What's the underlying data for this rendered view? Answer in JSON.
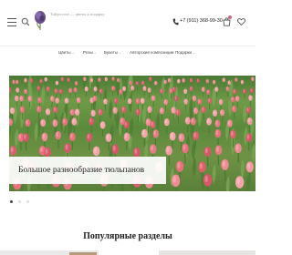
{
  "header": {
    "tagline": "Tulips-rose — цветы к подарку",
    "phone": "+7 (911) 368-99-30",
    "icons": [
      "menu-icon",
      "search-icon",
      "phone-icon",
      "cart-icon",
      "heart-icon"
    ]
  },
  "nav": {
    "items": [
      {
        "label": "Цветы",
        "has_dropdown": true
      },
      {
        "label": "Розы",
        "has_dropdown": true
      },
      {
        "label": "Букеты",
        "has_dropdown": true
      },
      {
        "label": "Авторские композиции",
        "has_dropdown": false
      },
      {
        "label": "Подарки",
        "has_dropdown": true
      }
    ]
  },
  "hero": {
    "caption": "Большое разнообразие тюльпанов",
    "slides_total": 3,
    "active_slide": 1
  },
  "popular": {
    "title": "Популярные разделы"
  },
  "colors": {
    "accent": "#c76a80",
    "text": "#222222",
    "muted": "#999999",
    "tulip_pink": "#e9707c",
    "stem_green": "#5b8a3c"
  }
}
